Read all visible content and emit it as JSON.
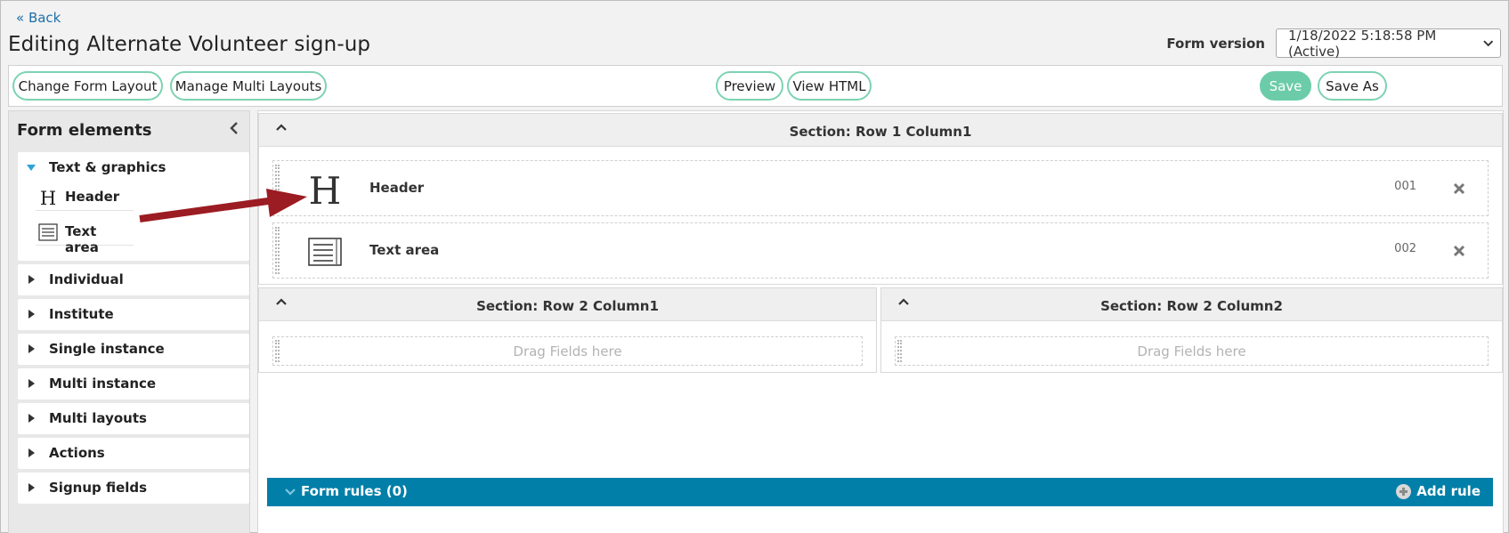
{
  "header": {
    "back_label": "« Back",
    "title": "Editing Alternate Volunteer sign-up",
    "version_label": "Form version",
    "version_value": "1/18/2022 5:18:58 PM (Active)"
  },
  "toolbar": {
    "change_layout": "Change Form Layout",
    "manage_multi_layouts": "Manage Multi Layouts",
    "preview": "Preview",
    "view_html": "View HTML",
    "save": "Save",
    "save_as": "Save As"
  },
  "sidebar": {
    "title": "Form elements",
    "expanded_category": {
      "label": "Text & graphics",
      "items": [
        {
          "label": "Header",
          "icon": "header-icon"
        },
        {
          "label": "Text area",
          "icon": "text-area-icon"
        }
      ]
    },
    "categories": [
      "Individual",
      "Institute",
      "Single instance",
      "Multi instance",
      "Multi layouts",
      "Actions",
      "Signup fields"
    ]
  },
  "sections": {
    "row1": {
      "title": "Section: Row 1 Column1",
      "fields": [
        {
          "label": "Header",
          "code": "001",
          "icon": "header-icon"
        },
        {
          "label": "Text area",
          "code": "002",
          "icon": "text-area-icon"
        }
      ]
    },
    "row2col1": {
      "title": "Section: Row 2 Column1",
      "placeholder": "Drag Fields here"
    },
    "row2col2": {
      "title": "Section: Row 2 Column2",
      "placeholder": "Drag Fields here"
    }
  },
  "rules": {
    "title": "Form rules (0)",
    "add_label": "Add rule"
  },
  "colors": {
    "accent_green": "#6cccaa",
    "rules_bar": "#017fa9",
    "arrow": "#9b1c22"
  }
}
